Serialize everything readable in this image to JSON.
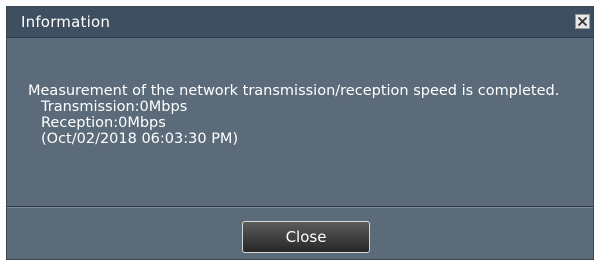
{
  "dialog": {
    "title": "Information",
    "message": {
      "line1": "Measurement of the network transmission/reception speed is completed.",
      "transmission": "Transmission:0Mbps",
      "reception": "Reception:0Mbps",
      "timestamp": "(Oct/02/2018 06:03:30 PM)"
    },
    "close_button_label": "Close",
    "close_icon": "close-icon"
  },
  "colors": {
    "dialog_body": "#5b6b7a",
    "titlebar": "#3d4f60",
    "button": "#262626"
  }
}
